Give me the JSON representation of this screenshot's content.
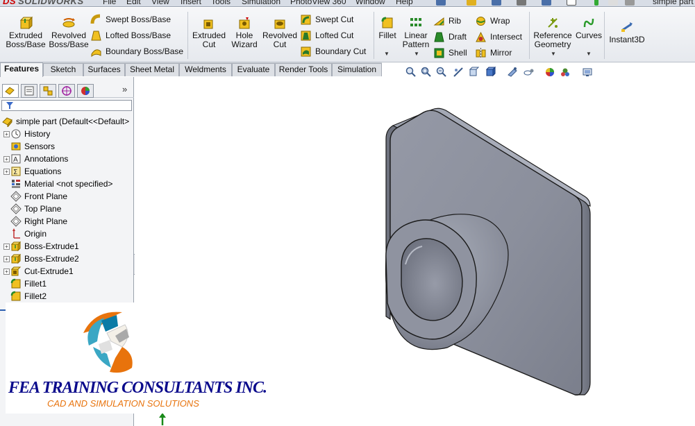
{
  "app": {
    "brand_prefix": "DS",
    "brand_name": "SOLIDWORKS",
    "document_title": "simple part"
  },
  "menu": [
    "File",
    "Edit",
    "View",
    "Insert",
    "Tools",
    "Simulation",
    "PhotoView 360",
    "Window",
    "Help"
  ],
  "ribbon": {
    "extruded_boss": "Extruded\nBoss/Base",
    "revolved_boss": "Revolved\nBoss/Base",
    "swept_boss": "Swept Boss/Base",
    "lofted_boss": "Lofted Boss/Base",
    "boundary_boss": "Boundary Boss/Base",
    "extruded_cut": "Extruded\nCut",
    "hole_wizard": "Hole\nWizard",
    "revolved_cut": "Revolved\nCut",
    "swept_cut": "Swept Cut",
    "lofted_cut": "Lofted Cut",
    "boundary_cut": "Boundary Cut",
    "fillet": "Fillet",
    "linear_pattern": "Linear\nPattern",
    "rib": "Rib",
    "draft": "Draft",
    "shell": "Shell",
    "wrap": "Wrap",
    "intersect": "Intersect",
    "mirror": "Mirror",
    "reference_geometry": "Reference\nGeometry",
    "curves": "Curves",
    "instant3d": "Instant3D"
  },
  "tabs": [
    "Features",
    "Sketch",
    "Surfaces",
    "Sheet Metal",
    "Weldments",
    "Evaluate",
    "Render Tools",
    "Simulation"
  ],
  "active_tab": "Features",
  "feature_tree": {
    "root": "simple part  (Default<<Default>",
    "items": [
      {
        "label": "History",
        "icon": "history-icon",
        "expandable": true
      },
      {
        "label": "Sensors",
        "icon": "sensor-icon",
        "expandable": false
      },
      {
        "label": "Annotations",
        "icon": "annotation-icon",
        "expandable": true
      },
      {
        "label": "Equations",
        "icon": "equation-icon",
        "expandable": true
      },
      {
        "label": "Material <not specified>",
        "icon": "material-icon",
        "expandable": false
      },
      {
        "label": "Front Plane",
        "icon": "plane-icon",
        "expandable": false
      },
      {
        "label": "Top Plane",
        "icon": "plane-icon",
        "expandable": false
      },
      {
        "label": "Right Plane",
        "icon": "plane-icon",
        "expandable": false
      },
      {
        "label": "Origin",
        "icon": "origin-icon",
        "expandable": false
      },
      {
        "label": "Boss-Extrude1",
        "icon": "boss-extrude-icon",
        "expandable": true
      },
      {
        "label": "Boss-Extrude2",
        "icon": "boss-extrude-icon",
        "expandable": true
      },
      {
        "label": "Cut-Extrude1",
        "icon": "cut-extrude-icon",
        "expandable": true
      },
      {
        "label": "Fillet1",
        "icon": "fillet-icon",
        "expandable": false
      },
      {
        "label": "Fillet2",
        "icon": "fillet-icon",
        "expandable": false
      }
    ]
  },
  "logo": {
    "company": "FEA TRAINING  CONSULTANTS INC.",
    "tagline": "CAD AND SIMULATION SOLUTIONS"
  },
  "colors": {
    "part_face": "#8e939f",
    "part_shadow": "#6c707a",
    "logo_blue": "#0a0a8c",
    "logo_orange": "#e8730c",
    "logo_teal": "#3aa7c4",
    "brand_red": "#cc0000"
  }
}
